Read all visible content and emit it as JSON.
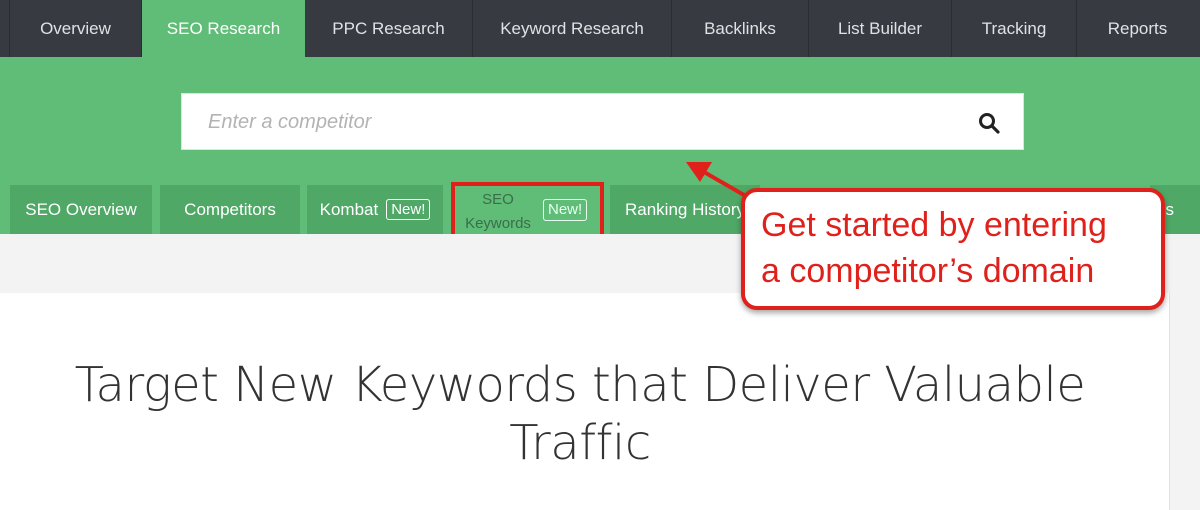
{
  "topnav": {
    "tabs": [
      {
        "label": "Overview"
      },
      {
        "label": "SEO Research",
        "active": true
      },
      {
        "label": "PPC Research"
      },
      {
        "label": "Keyword Research"
      },
      {
        "label": "Backlinks"
      },
      {
        "label": "List Builder"
      },
      {
        "label": "Tracking"
      },
      {
        "label": "Reports"
      }
    ]
  },
  "search": {
    "placeholder": "Enter a competitor",
    "icon": "search-icon"
  },
  "subtabs": {
    "seo_overview": "SEO Overview",
    "competitors": "Competitors",
    "kombat": "Kombat",
    "kombat_badge": "New!",
    "seo_keywords_line1": "SEO",
    "seo_keywords_line2": "Keywords",
    "seo_keywords_badge": "New!",
    "ranking_history": "Ranking History",
    "partial_tail": "s"
  },
  "headline": {
    "line1": "Target New Keywords that Deliver Valuable",
    "line2": "Traffic"
  },
  "callout": {
    "line1": "Get started by entering",
    "line2": "a competitor’s domain"
  },
  "colors": {
    "nav_bg": "#373b41",
    "brand_green": "#5fbd78",
    "subtab_green": "#4fa866",
    "annotation_red": "#e0211b"
  }
}
